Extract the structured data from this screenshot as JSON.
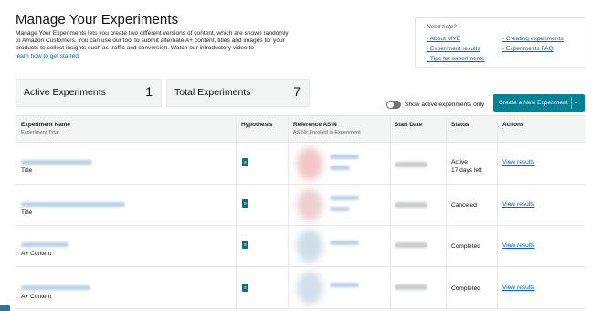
{
  "header": {
    "title": "Manage Your Experiments",
    "intro_line1": "Manage Your Experiments lets you create two different versions of content, which are shown randomly",
    "intro_line2": "to Amazon Customers. You can use our tool to submit alternate A+ content, titles and images for your",
    "intro_line3": "products to collect insights such as traffic and conversion. Watch our introductory video to",
    "intro_link": "learn how to get started."
  },
  "help": {
    "title": "Need help?",
    "links": [
      "- About MYE",
      "- Experiment results",
      "- Tips for experiments",
      "- Creating experiments",
      "- Experiments FAQ"
    ]
  },
  "stats": {
    "active_label": "Active Experiments",
    "active_value": "1",
    "total_label": "Total Experiments",
    "total_value": "7"
  },
  "toolbar": {
    "toggle_label": "Show active experiments only",
    "toggle_on": false,
    "create_label": "Create a New Experiment",
    "create_caret": "⌄"
  },
  "table": {
    "headers": {
      "name": "Experiment Name",
      "name_sub": "Experiment Type",
      "hypothesis": "Hypothesis",
      "asin": "Reference ASIN",
      "asin_sub": "ASINs Enrolled in Experiment",
      "start": "Start Date",
      "status": "Status",
      "actions": "Actions"
    },
    "rows": [
      {
        "type": "Title",
        "status": "Active",
        "status_sub": "17 days left",
        "action": "View results"
      },
      {
        "type": "Title",
        "status": "Canceled",
        "status_sub": "",
        "action": "View results"
      },
      {
        "type": "A+ Content",
        "status": "Completed",
        "status_sub": "",
        "action": "View results"
      },
      {
        "type": "A+ Content",
        "status": "Completed",
        "status_sub": "",
        "action": "View results"
      }
    ]
  },
  "colors": {
    "accent": "#008296",
    "link": "#0066c0",
    "header_bg": "#f3f4f4",
    "icon": "#0f6e7a"
  },
  "icons": {
    "hypothesis": "document-icon",
    "toggle": "toggle-switch"
  }
}
